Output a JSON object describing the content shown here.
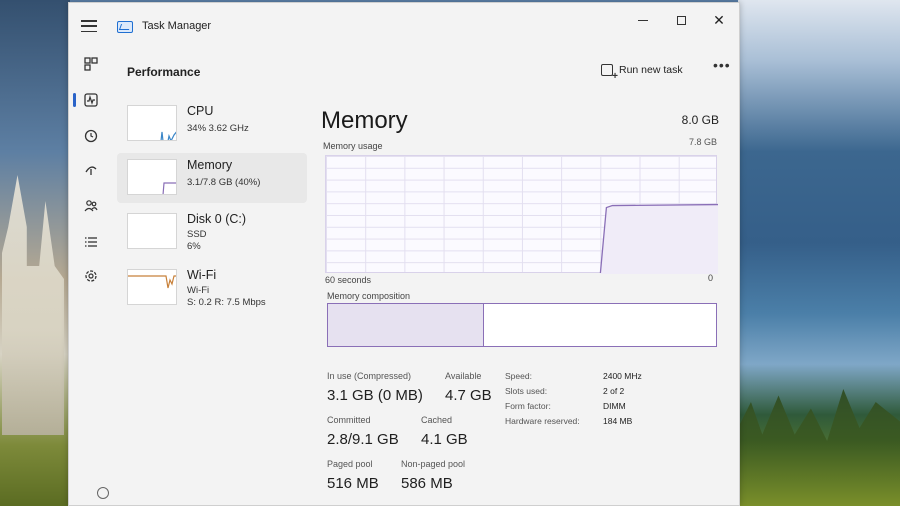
{
  "window": {
    "app_title": "Task Manager",
    "close_glyph": "✕"
  },
  "icons": {
    "menu": "hamburger-menu-icon",
    "app": "task-manager-icon",
    "nav": [
      "processes-icon",
      "performance-icon",
      "app-history-icon",
      "startup-apps-icon",
      "users-icon",
      "details-icon",
      "services-icon",
      "settings-icon"
    ]
  },
  "header": {
    "page_title": "Performance",
    "run_new_task": "Run new task",
    "more": "•••"
  },
  "devices": [
    {
      "name": "CPU",
      "sub1": "34%  3.62 GHz",
      "sub2": "",
      "sub3": ""
    },
    {
      "name": "Memory",
      "sub1": "3.1/7.8 GB (40%)",
      "sub2": "",
      "sub3": ""
    },
    {
      "name": "Disk 0 (C:)",
      "sub1": "SSD",
      "sub2": "6%",
      "sub3": ""
    },
    {
      "name": "Wi-Fi",
      "sub1": "Wi-Fi",
      "sub2": "S: 0.2  R: 7.5 Mbps",
      "sub3": ""
    }
  ],
  "memory": {
    "title": "Memory",
    "total": "8.0 GB",
    "usage_label": "Memory usage",
    "usage_max": "7.8 GB",
    "time_left": "60 seconds",
    "time_right": "0",
    "composition_label": "Memory composition",
    "composition_in_use_fraction": 0.4,
    "usage_level_fraction": 0.4
  },
  "stats": {
    "in_use_label": "In use (Compressed)",
    "in_use_value": "3.1 GB (0 MB)",
    "available_label": "Available",
    "available_value": "4.7 GB",
    "committed_label": "Committed",
    "committed_value": "2.8/9.1 GB",
    "cached_label": "Cached",
    "cached_value": "4.1 GB",
    "paged_label": "Paged pool",
    "paged_value": "516 MB",
    "nonpaged_label": "Non-paged pool",
    "nonpaged_value": "586 MB"
  },
  "specs": {
    "speed_label": "Speed:",
    "speed_value": "2400 MHz",
    "slots_label": "Slots used:",
    "slots_value": "2 of 2",
    "form_label": "Form factor:",
    "form_value": "DIMM",
    "reserved_label": "Hardware reserved:",
    "reserved_value": "184 MB"
  },
  "colors": {
    "accent": "#8a6fb7",
    "nav_indicator": "#2a63c8"
  }
}
